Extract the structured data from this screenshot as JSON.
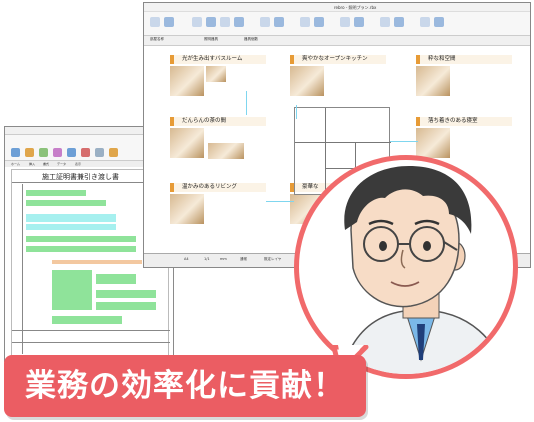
{
  "back_window": {
    "document_title": "施工証明書兼引き渡し書",
    "tabs": [
      "ホーム",
      "挿入",
      "書式",
      "データ",
      "表示"
    ],
    "field_labels": [
      "工事名称",
      "工事場所",
      "施工者",
      "工事期間"
    ]
  },
  "front_window": {
    "window_title": "rebro - 照明プラン.rbx",
    "toolbar_fields": [
      "部屋名称",
      "照明器具",
      "器具個数"
    ],
    "panels": [
      {
        "title": "光が生み出すバスルーム"
      },
      {
        "title": "爽やかなオープンキッチン"
      },
      {
        "title": "粋な和空間"
      },
      {
        "title": "だんらんの茶の間"
      },
      {
        "title": "落ち着きのある寝室"
      },
      {
        "title": "温かみのあるリビング"
      },
      {
        "title": "豪華な"
      }
    ],
    "status_items": [
      "A4",
      "1/1",
      "mm",
      "通常",
      "既定レイヤ"
    ]
  },
  "banner": {
    "text": "業務の効率化に貢献！"
  },
  "colors": {
    "accent": "#eb5d63",
    "circle_border": "#f16a6b",
    "panel_accent": "#e79b36",
    "cell_green": "#8fe39a",
    "cell_cyan": "#a6f0ef"
  },
  "illustration": {
    "subject": "scientist-with-glasses"
  }
}
